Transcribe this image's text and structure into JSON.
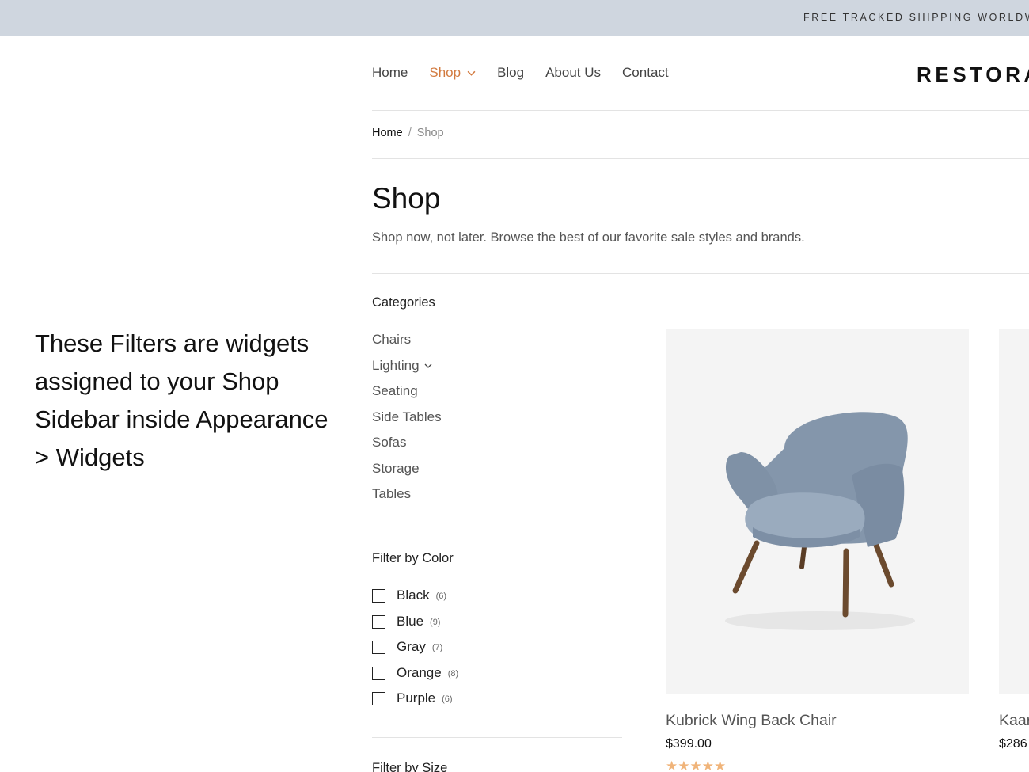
{
  "topbar": {
    "text": "FREE TRACKED SHIPPING WORLDW"
  },
  "nav": {
    "items": [
      {
        "label": "Home"
      },
      {
        "label": "Shop"
      },
      {
        "label": "Blog"
      },
      {
        "label": "About Us"
      },
      {
        "label": "Contact"
      }
    ],
    "active": "Shop",
    "accent_color": "#d27a3f"
  },
  "logo": {
    "text": "RESTORA"
  },
  "breadcrumb": {
    "home": "Home",
    "separator": "/",
    "current": "Shop"
  },
  "page": {
    "title": "Shop",
    "description": "Shop now, not later. Browse the best of our favorite sale styles and brands."
  },
  "categories": {
    "title": "Categories",
    "items": [
      {
        "label": "Chairs"
      },
      {
        "label": "Lighting"
      },
      {
        "label": "Seating"
      },
      {
        "label": "Side Tables"
      },
      {
        "label": "Sofas"
      },
      {
        "label": "Storage"
      },
      {
        "label": "Tables"
      }
    ]
  },
  "color_filter": {
    "title": "Filter by Color",
    "items": [
      {
        "label": "Black",
        "count": "(6)"
      },
      {
        "label": "Blue",
        "count": "(9)"
      },
      {
        "label": "Gray",
        "count": "(7)"
      },
      {
        "label": "Orange",
        "count": "(8)"
      },
      {
        "label": "Purple",
        "count": "(6)"
      }
    ]
  },
  "size_filter": {
    "title": "Filter by Size"
  },
  "annotation": {
    "text": "These Filters are widgets assigned to your Shop Sidebar inside Appearance > Widgets"
  },
  "products": [
    {
      "name": "Kubrick Wing Back Chair",
      "price": "$399.00",
      "rating": 5
    },
    {
      "name": "Kaar",
      "price": "$286"
    }
  ],
  "colors": {
    "topbar_bg": "#cfd6df",
    "star": "#f0b47a",
    "chair": "#8c9db0"
  }
}
